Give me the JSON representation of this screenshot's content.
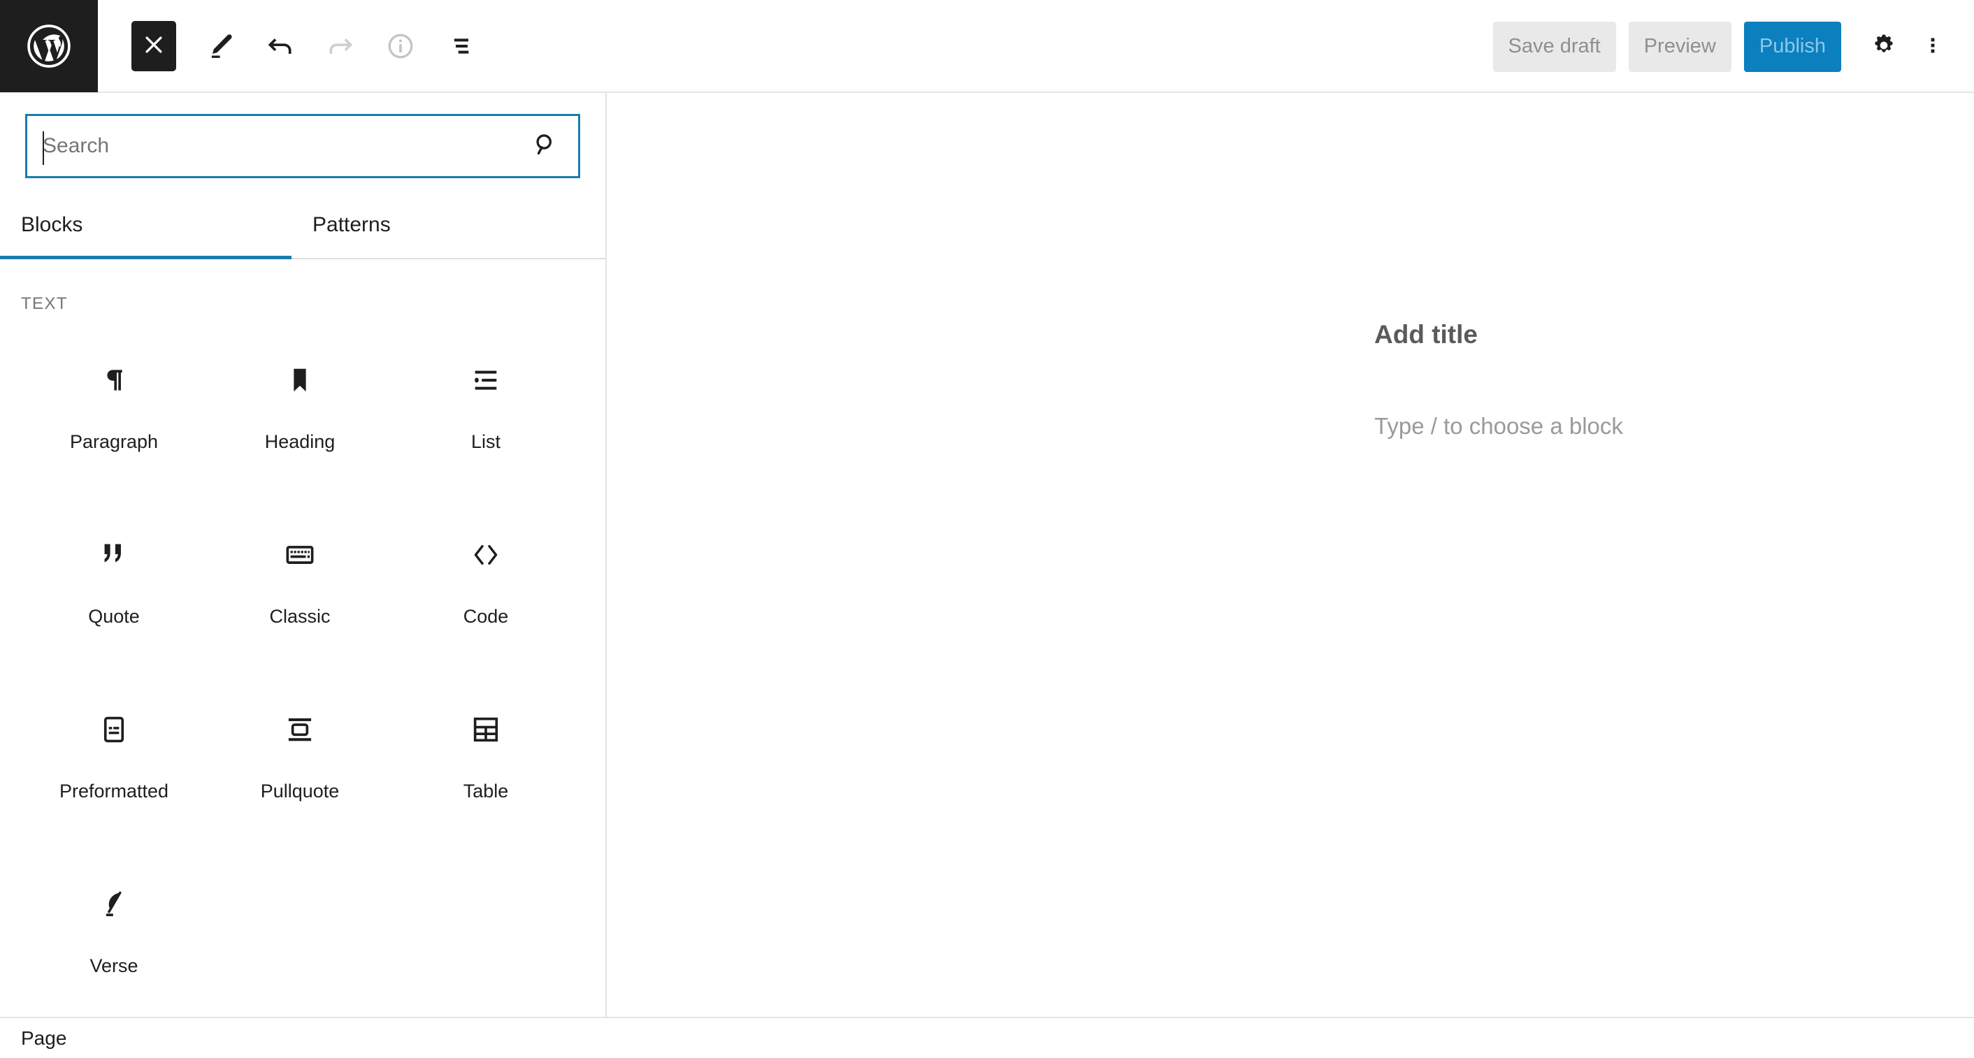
{
  "header": {
    "logo_icon": "wordpress-logo-icon",
    "left_tools": [
      {
        "name": "close-editor-button",
        "icon": "close-icon",
        "label": "Close"
      },
      {
        "name": "edit-mode-button",
        "icon": "pencil-icon",
        "label": "Edit"
      },
      {
        "name": "undo-button",
        "icon": "undo-arrow-icon",
        "label": "Undo"
      },
      {
        "name": "redo-button",
        "icon": "redo-arrow-icon",
        "label": "Redo"
      },
      {
        "name": "details-button",
        "icon": "info-circle-icon",
        "label": "Details"
      },
      {
        "name": "list-view-button",
        "icon": "list-view-icon",
        "label": "List View"
      }
    ],
    "save_draft_label": "Save draft",
    "preview_label": "Preview",
    "publish_label": "Publish",
    "settings_icon": "gear-icon",
    "more_options_icon": "more-vertical-icon"
  },
  "inserter": {
    "search": {
      "value": "",
      "placeholder": "Search",
      "icon": "search-icon"
    },
    "tabs": [
      {
        "label": "Blocks",
        "active": true
      },
      {
        "label": "Patterns",
        "active": false
      }
    ],
    "categories": [
      {
        "label": "TEXT",
        "blocks": [
          {
            "label": "Paragraph",
            "icon": "pilcrow-icon"
          },
          {
            "label": "Heading",
            "icon": "bookmark-icon"
          },
          {
            "label": "List",
            "icon": "list-icon"
          },
          {
            "label": "Quote",
            "icon": "quotation-marks-icon"
          },
          {
            "label": "Classic",
            "icon": "keyboard-icon"
          },
          {
            "label": "Code",
            "icon": "angle-brackets-icon"
          },
          {
            "label": "Preformatted",
            "icon": "preformatted-icon"
          },
          {
            "label": "Pullquote",
            "icon": "pullquote-icon"
          },
          {
            "label": "Table",
            "icon": "table-grid-icon"
          },
          {
            "label": "Verse",
            "icon": "feather-quill-icon"
          }
        ]
      }
    ]
  },
  "editor": {
    "title_placeholder": "Add title",
    "block_placeholder": "Type / to choose a block",
    "add_block_icon": "plus-icon"
  },
  "bottom_bar": {
    "breadcrumb": "Page"
  },
  "colors": {
    "brand_dark": "#1e1e1e",
    "accent_blue": "#0c7fbe",
    "focus_blue": "#1b7cb0",
    "border_gray": "#e2e4e7",
    "muted_text": "#757575"
  }
}
